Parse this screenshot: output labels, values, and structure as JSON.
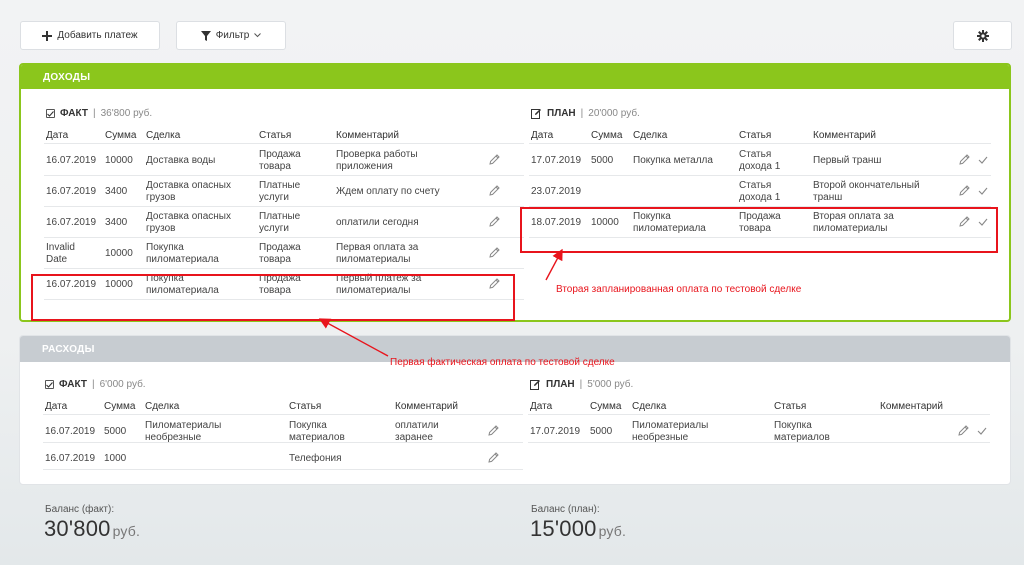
{
  "toolbar": {
    "add_label": "Добавить платеж",
    "filter_label": "Фильтр"
  },
  "income": {
    "title": "ДОХОДЫ",
    "fact": {
      "label": "ФАКТ",
      "sum": "36'800 руб.",
      "columns": [
        "Дата",
        "Сумма",
        "Сделка",
        "Статья",
        "Комментарий"
      ],
      "rows": [
        {
          "date": "16.07.2019",
          "amount": "10000",
          "deal": "Доставка воды",
          "item": "Продажа\nтовара",
          "comment": "Проверка работы\nприложения"
        },
        {
          "date": "16.07.2019",
          "amount": "3400",
          "deal": "Доставка опасных\nгрузов",
          "item": "Платные\nуслуги",
          "comment": "Ждем оплату по счету"
        },
        {
          "date": "16.07.2019",
          "amount": "3400",
          "deal": "Доставка опасных\nгрузов",
          "item": "Платные\nуслуги",
          "comment": "оплатили сегодня"
        },
        {
          "date": "Invalid\nDate",
          "amount": "10000",
          "deal": "Покупка\nпиломатериала",
          "item": "Продажа\nтовара",
          "comment": "Первая оплата за\nпиломатериалы"
        },
        {
          "date": "16.07.2019",
          "amount": "10000",
          "deal": "Покупка\nпиломатериала",
          "item": "Продажа\nтовара",
          "comment": "Первый платеж за\nпиломатериалы"
        }
      ]
    },
    "plan": {
      "label": "ПЛАН",
      "sum": "20'000 руб.",
      "columns": [
        "Дата",
        "Сумма",
        "Сделка",
        "Статья",
        "Комментарий"
      ],
      "rows": [
        {
          "date": "17.07.2019",
          "amount": "5000",
          "deal": "Покупка металла",
          "item": "Статья\nдохода 1",
          "comment": "Первый транш"
        },
        {
          "date": "23.07.2019",
          "amount": "",
          "deal": "",
          "item": "Статья\nдохода 1",
          "comment": "Второй окончательный\nтранш"
        },
        {
          "date": "18.07.2019",
          "amount": "10000",
          "deal": "Покупка\nпиломатериала",
          "item": "Продажа\nтовара",
          "comment": "Вторая оплата за\nпиломатериалы"
        }
      ]
    }
  },
  "expense": {
    "title": "РАСХОДЫ",
    "fact": {
      "label": "ФАКТ",
      "sum": "6'000 руб.",
      "columns": [
        "Дата",
        "Сумма",
        "Сделка",
        "Статья",
        "Комментарий"
      ],
      "rows": [
        {
          "date": "16.07.2019",
          "amount": "5000",
          "deal": "Пиломатериалы\nнеобрезные",
          "item": "Покупка\nматериалов",
          "comment": "оплатили\nзаранее"
        },
        {
          "date": "16.07.2019",
          "amount": "1000",
          "deal": "",
          "item": "Телефония",
          "comment": ""
        }
      ]
    },
    "plan": {
      "label": "ПЛАН",
      "sum": "5'000 руб.",
      "columns": [
        "Дата",
        "Сумма",
        "Сделка",
        "Статья",
        "Комментарий"
      ],
      "rows": [
        {
          "date": "17.07.2019",
          "amount": "5000",
          "deal": "Пиломатериалы\nнеобрезные",
          "item": "Покупка\nматериалов",
          "comment": ""
        }
      ]
    }
  },
  "balance": {
    "fact_label": "Баланс (факт):",
    "fact_value": "30'800",
    "plan_label": "Баланс (план):",
    "plan_value": "15'000",
    "currency": "руб."
  },
  "annotations": {
    "plan": "Вторая запланированная оплата по тестовой сделке",
    "fact": "Первая фактическая оплата по тестовой сделке"
  },
  "colors": {
    "income_header": "#8bc61c",
    "expense_header": "#c7ccd1",
    "annotation": "#e8141c"
  }
}
